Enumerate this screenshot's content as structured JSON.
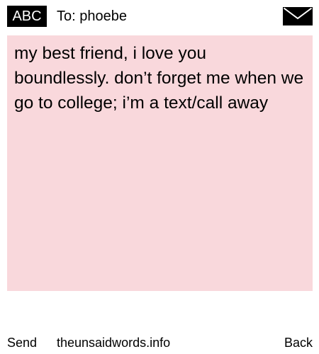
{
  "header": {
    "mode_label": "ABC",
    "to_label": "To: phoebe",
    "icon": "envelope-icon"
  },
  "message": {
    "text": "my best friend, i love you boundlessly. don’t forget me when we go to college; i’m a text/call away"
  },
  "softkeys": {
    "left": "Send",
    "center": "theunsaidwords.info",
    "right": "Back"
  },
  "colors": {
    "message_background": "#f9d8dc",
    "badge_background": "#000000",
    "badge_text": "#ffffff",
    "page_background": "#ffffff",
    "text": "#000000"
  }
}
